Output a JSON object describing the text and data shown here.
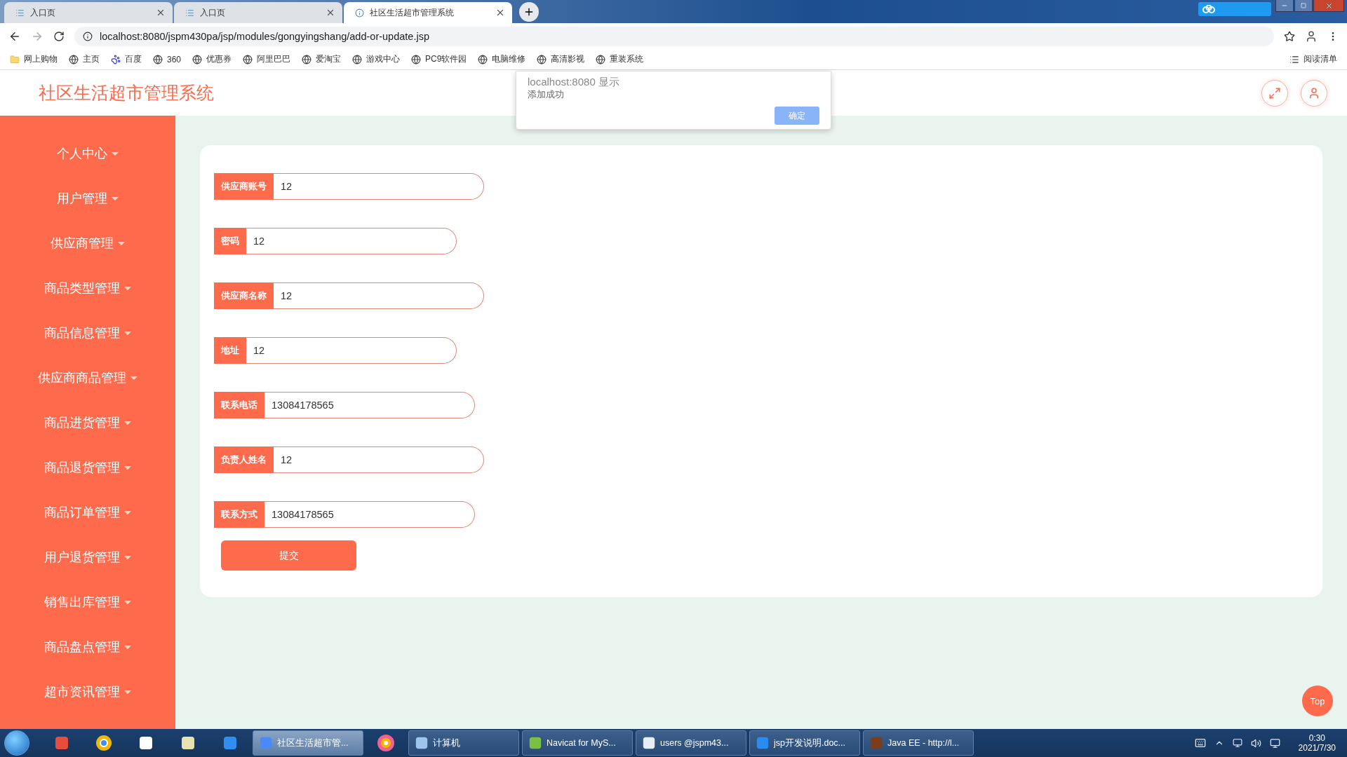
{
  "browser": {
    "tabs": [
      {
        "title": "入口页",
        "selected": false
      },
      {
        "title": "入口页",
        "selected": false
      },
      {
        "title": "社区生活超市管理系统",
        "selected": true
      }
    ],
    "address": "localhost:8080/jspm430pa/jsp/modules/gongyingshang/add-or-update.jsp",
    "bookmarks": [
      {
        "label": "网上购物",
        "kind": "folder"
      },
      {
        "label": "主页",
        "kind": "site"
      },
      {
        "label": "百度",
        "kind": "paw"
      },
      {
        "label": "360",
        "kind": "site"
      },
      {
        "label": "优惠券",
        "kind": "site"
      },
      {
        "label": "阿里巴巴",
        "kind": "site"
      },
      {
        "label": "爱淘宝",
        "kind": "site"
      },
      {
        "label": "游戏中心",
        "kind": "site"
      },
      {
        "label": "PC9软件园",
        "kind": "site"
      },
      {
        "label": "电脑维修",
        "kind": "site"
      },
      {
        "label": "高清影视",
        "kind": "site"
      },
      {
        "label": "重装系统",
        "kind": "site"
      }
    ],
    "reading_list": "阅读清单"
  },
  "dialog": {
    "title": "localhost:8080 显示",
    "message": "添加成功",
    "button": "确定"
  },
  "app": {
    "title": "社区生活超市管理系统",
    "sidebar": [
      {
        "label": "个人中心"
      },
      {
        "label": "用户管理"
      },
      {
        "label": "供应商管理"
      },
      {
        "label": "商品类型管理"
      },
      {
        "label": "商品信息管理"
      },
      {
        "label": "供应商商品管理"
      },
      {
        "label": "商品进货管理"
      },
      {
        "label": "商品退货管理"
      },
      {
        "label": "商品订单管理"
      },
      {
        "label": "用户退货管理"
      },
      {
        "label": "销售出库管理"
      },
      {
        "label": "商品盘点管理"
      },
      {
        "label": "超市资讯管理"
      }
    ],
    "fields": [
      {
        "label": "供应商账号",
        "value": "12"
      },
      {
        "label": "密码",
        "value": "12"
      },
      {
        "label": "供应商名称",
        "value": "12"
      },
      {
        "label": "地址",
        "value": "12"
      },
      {
        "label": "联系电话",
        "value": "13084178565"
      },
      {
        "label": "负责人姓名",
        "value": "12"
      },
      {
        "label": "联系方式",
        "value": "13084178565"
      }
    ],
    "submit": "提交",
    "top_button": "Top"
  },
  "taskbar": {
    "tasks": [
      {
        "label": "社区生活超市管...",
        "selected": true
      },
      {
        "label": "计算机",
        "selected": false
      },
      {
        "label": "Navicat for MyS...",
        "selected": false
      },
      {
        "label": "users @jspm43...",
        "selected": false
      },
      {
        "label": "jsp开发说明.doc...",
        "selected": false
      },
      {
        "label": "Java EE - http://l...",
        "selected": false
      }
    ],
    "time": "0:30",
    "date": "2021/7/30"
  }
}
